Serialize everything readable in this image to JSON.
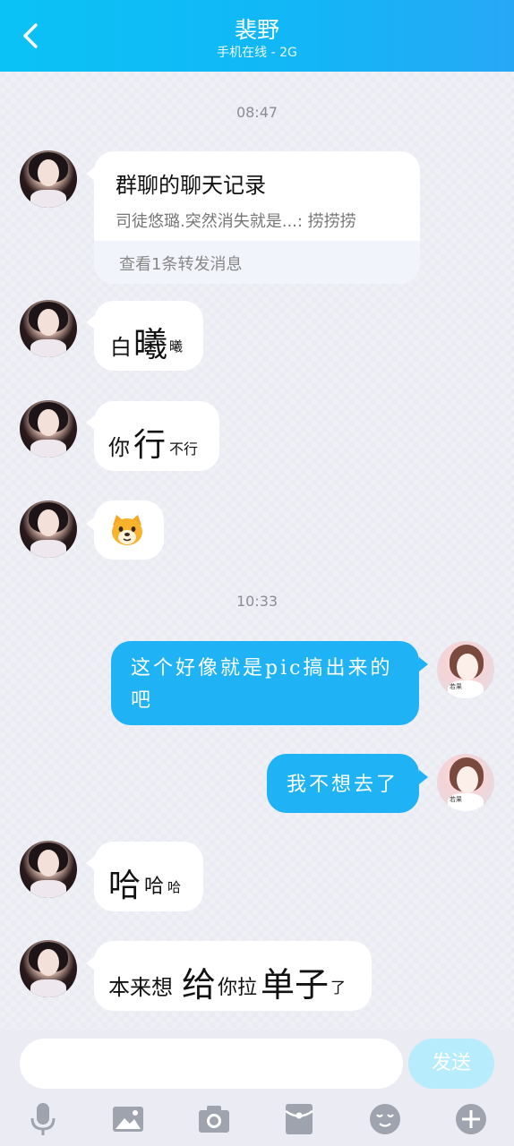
{
  "header": {
    "title": "裴野",
    "subtitle": "手机在线 - 2G"
  },
  "times": {
    "t1": "08:47",
    "t2": "10:33"
  },
  "messages": {
    "forward": {
      "title": "群聊的聊天记录",
      "line": "司徒悠璐.突然消失就是...:  捞捞捞",
      "footer": "查看1条转发消息"
    },
    "m2": {
      "a": "白",
      "b": "曦",
      "c": "曦"
    },
    "m3": {
      "a": "你",
      "b": "行",
      "c": "不行"
    },
    "m5": {
      "line1": "这个好像就是pic搞出来的",
      "line2": "吧"
    },
    "m6": {
      "text": "我不想去了"
    },
    "m7": {
      "a": "哈",
      "b": "哈",
      "c": "哈"
    },
    "m8": {
      "a": "本来想",
      "b": "给",
      "c": "你拉",
      "d": "单子",
      "e": "了"
    }
  },
  "self_avatar_caption": "若果\n以往曾流",
  "input": {
    "send_label": "发送"
  },
  "icons": [
    "back-icon",
    "dog-emoji-icon",
    "mic-icon",
    "image-icon",
    "camera-icon",
    "red-packet-icon",
    "emoji-icon",
    "plus-icon"
  ],
  "colors": {
    "header": "#12b7f6",
    "bubble_self": "#1fb2f5",
    "send_disabled": "#b7ecfc"
  }
}
